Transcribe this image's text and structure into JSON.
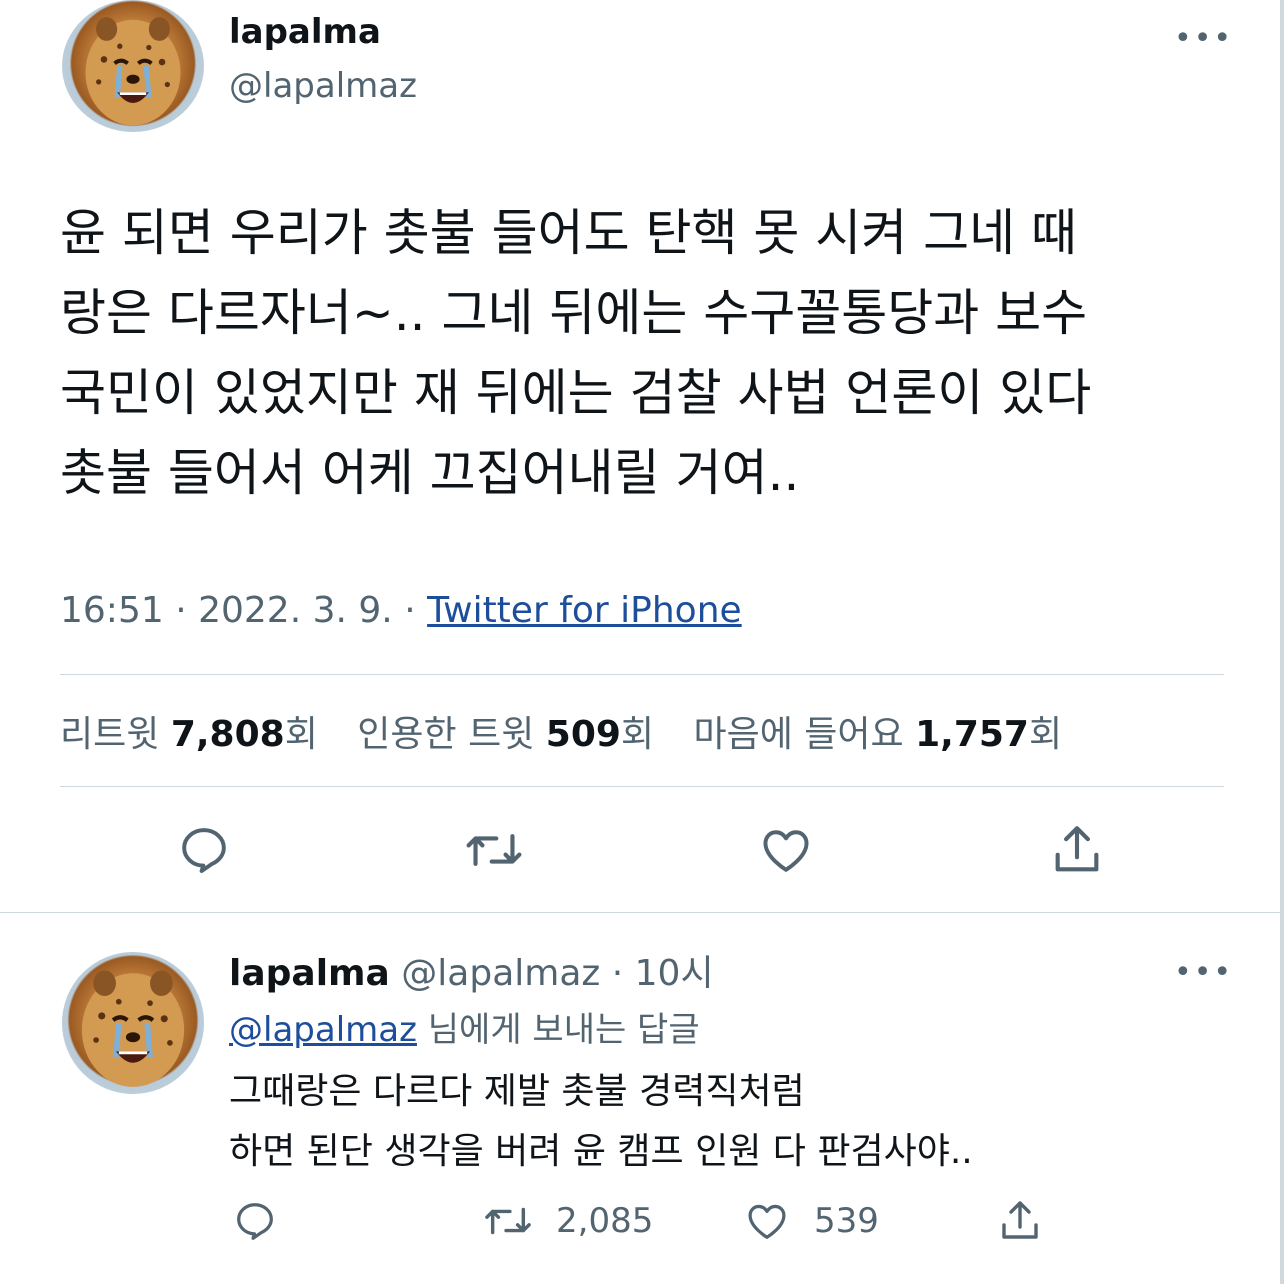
{
  "tweet": {
    "author_name": "lapalma",
    "author_handle": "@lapalmaz",
    "more_label": "•••",
    "lines": [
      "윤 되면 우리가 촛불 들어도 탄핵 못 시켜 그네 때",
      "랑은 다르자너~.. 그네 뒤에는 수구꼴통당과 보수",
      "국민이 있었지만 재 뒤에는 검찰 사법 언론이 있다",
      "촛불 들어서 어케 끄집어내릴 거여.."
    ],
    "time": "16:51",
    "date": "2022. 3. 9.",
    "separator": " · ",
    "source": "Twitter for iPhone",
    "stats": {
      "retweets_label": "리트윗 ",
      "retweets_value": "7,808",
      "quotes_label": "인용한 트윗 ",
      "quotes_value": "509",
      "likes_label": "마음에 들어요 ",
      "likes_value": "1,757",
      "unit": "회"
    },
    "actions": [
      "reply-icon",
      "retweet-icon",
      "like-icon",
      "share-icon"
    ]
  },
  "reply": {
    "author_name": "lapalma",
    "author_handle": "@lapalmaz",
    "time_ago": " · 10시",
    "replying_to_handle": "@lapalmaz",
    "replying_to_suffix": " 님에게 보내는 답글",
    "more_label": "•••",
    "lines": [
      "그때랑은 다르다 제발 촛불 경력직처럼",
      "하면 된단 생각을 버려 윤 캠프 인원 다 판검사야.."
    ],
    "retweet_count": "2,085",
    "like_count": "539"
  },
  "colors": {
    "text": "#0f1419",
    "muted": "#536471",
    "link": "#1d4e9b",
    "divider": "#cfd9de"
  }
}
